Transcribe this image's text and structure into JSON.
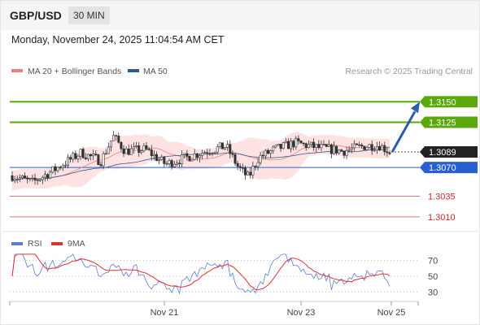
{
  "header": {
    "pair": "GBP/USD",
    "timeframe": "30 MIN",
    "datetime": "Monday, November 24, 2025 11:04:54 AM CET"
  },
  "legend": {
    "bb_label": "MA 20 + Bollinger Bands",
    "ma50_label": "MA 50",
    "credit": "Research © 2025 Trading Central"
  },
  "rsi_legend": {
    "rsi_label": "RSI",
    "ma_label": "9MA"
  },
  "colors": {
    "bb_band": "#ffe3e3",
    "ma20": "#f08080",
    "ma50": "#2e5c8e",
    "support": "#e57373",
    "resistance": "#5aa80b",
    "pivot": "#2a5fd1",
    "arrow": "#2b5eaa",
    "candle": "#333333",
    "rsi": "#5b7fd1",
    "rsi_ma": "#e03030"
  },
  "chart_data": [
    {
      "type": "candlestick",
      "title": "GBP/USD",
      "ylim": [
        1.2995,
        1.3175
      ],
      "x_labels": [
        "Nov 21",
        "Nov 23",
        "Nov 25"
      ],
      "levels": [
        {
          "value": 1.315,
          "label": "1.3150",
          "kind": "resistance"
        },
        {
          "value": 1.3125,
          "label": "1.3125",
          "kind": "resistance"
        },
        {
          "value": 1.3089,
          "label": "1.3089",
          "kind": "current"
        },
        {
          "value": 1.307,
          "label": "1.3070",
          "kind": "pivot"
        },
        {
          "value": 1.3035,
          "label": "1.3035",
          "kind": "support"
        },
        {
          "value": 1.301,
          "label": "1.3010",
          "kind": "support"
        }
      ],
      "forecast_target": 1.315
    },
    {
      "type": "line",
      "title": "RSI",
      "ylim": [
        20,
        80
      ],
      "yticks": [
        "70",
        "50",
        "30"
      ],
      "series": [
        {
          "name": "RSI"
        },
        {
          "name": "9MA"
        }
      ]
    }
  ]
}
